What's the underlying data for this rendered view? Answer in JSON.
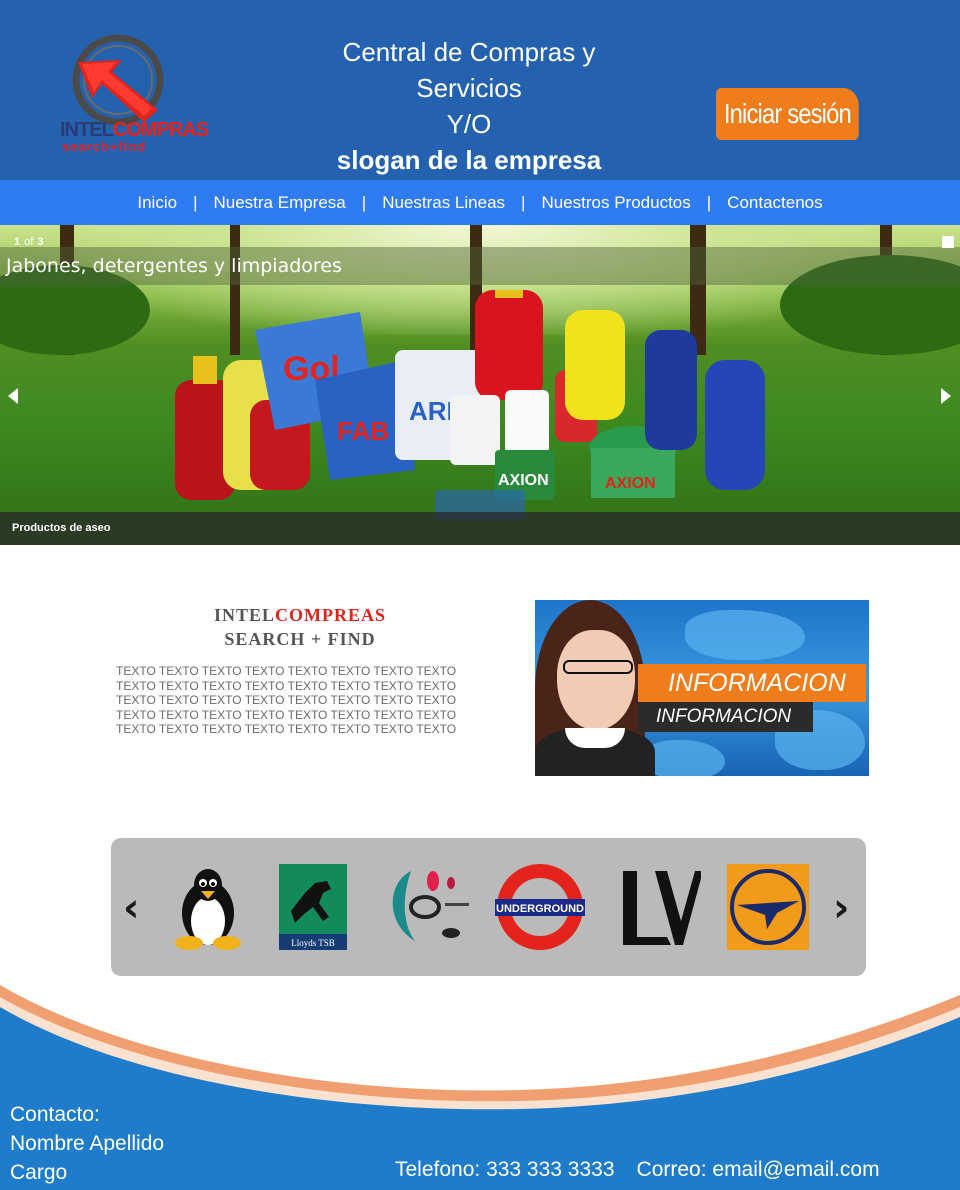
{
  "header": {
    "logo_text_a": "INTEL",
    "logo_text_b": "COMPRAS",
    "logo_sub": "search+find",
    "title_line1": "Central de Compras y",
    "title_line2": "Servicios",
    "title_line3": "Y/O",
    "slogan": "slogan de la empresa",
    "login_label": "Iniciar sesión"
  },
  "nav": {
    "items": [
      {
        "label": "Inicio"
      },
      {
        "label": "Nuestra Empresa"
      },
      {
        "label": "Nuestras Lineas"
      },
      {
        "label": "Nuestros Productos"
      },
      {
        "label": "Contactenos"
      }
    ],
    "separator": "|"
  },
  "slider": {
    "current": "1",
    "of": "of",
    "total": "3",
    "title": "Jabones, detergentes y limpiadores",
    "caption": "Productos de aseo"
  },
  "intro": {
    "brand_part1": "INTEL",
    "brand_part2": "COMPREAS",
    "brand_sub": "SEARCH + FIND",
    "lorem_lines": [
      "TEXTO TEXTO TEXTO TEXTO TEXTO TEXTO TEXTO TEXTO",
      "TEXTO TEXTO TEXTO TEXTO TEXTO TEXTO TEXTO TEXTO",
      "TEXTO TEXTO TEXTO TEXTO TEXTO TEXTO TEXTO TEXTO",
      "TEXTO TEXTO TEXTO TEXTO TEXTO TEXTO TEXTO TEXTO",
      "TEXTO TEXTO TEXTO TEXTO TEXTO TEXTO TEXTO TEXTO"
    ],
    "banner_main": "INFORMACION",
    "banner_sub": "INFORMACION"
  },
  "carousel": {
    "prev_icon": "chevron-left-icon",
    "next_icon": "chevron-right-icon",
    "logos": [
      {
        "name": "linux-tux-logo"
      },
      {
        "name": "lloyds-tsb-logo",
        "text": "Lloyds TSB"
      },
      {
        "name": "abstract-drop-logo"
      },
      {
        "name": "underground-logo",
        "text": "UNDERGROUND"
      },
      {
        "name": "louis-vuitton-logo"
      },
      {
        "name": "lufthansa-logo"
      }
    ]
  },
  "footer": {
    "contact_label": "Contacto:",
    "name": "Nombre Apellido",
    "role": "Cargo",
    "phone": "Telefono: 333 333 3333",
    "email": "Correo: email@email.com"
  },
  "colors": {
    "header_blue": "#2462b0",
    "nav_blue": "#2f7cf2",
    "orange": "#f07d1c",
    "footer_blue": "#1f7ccb"
  }
}
